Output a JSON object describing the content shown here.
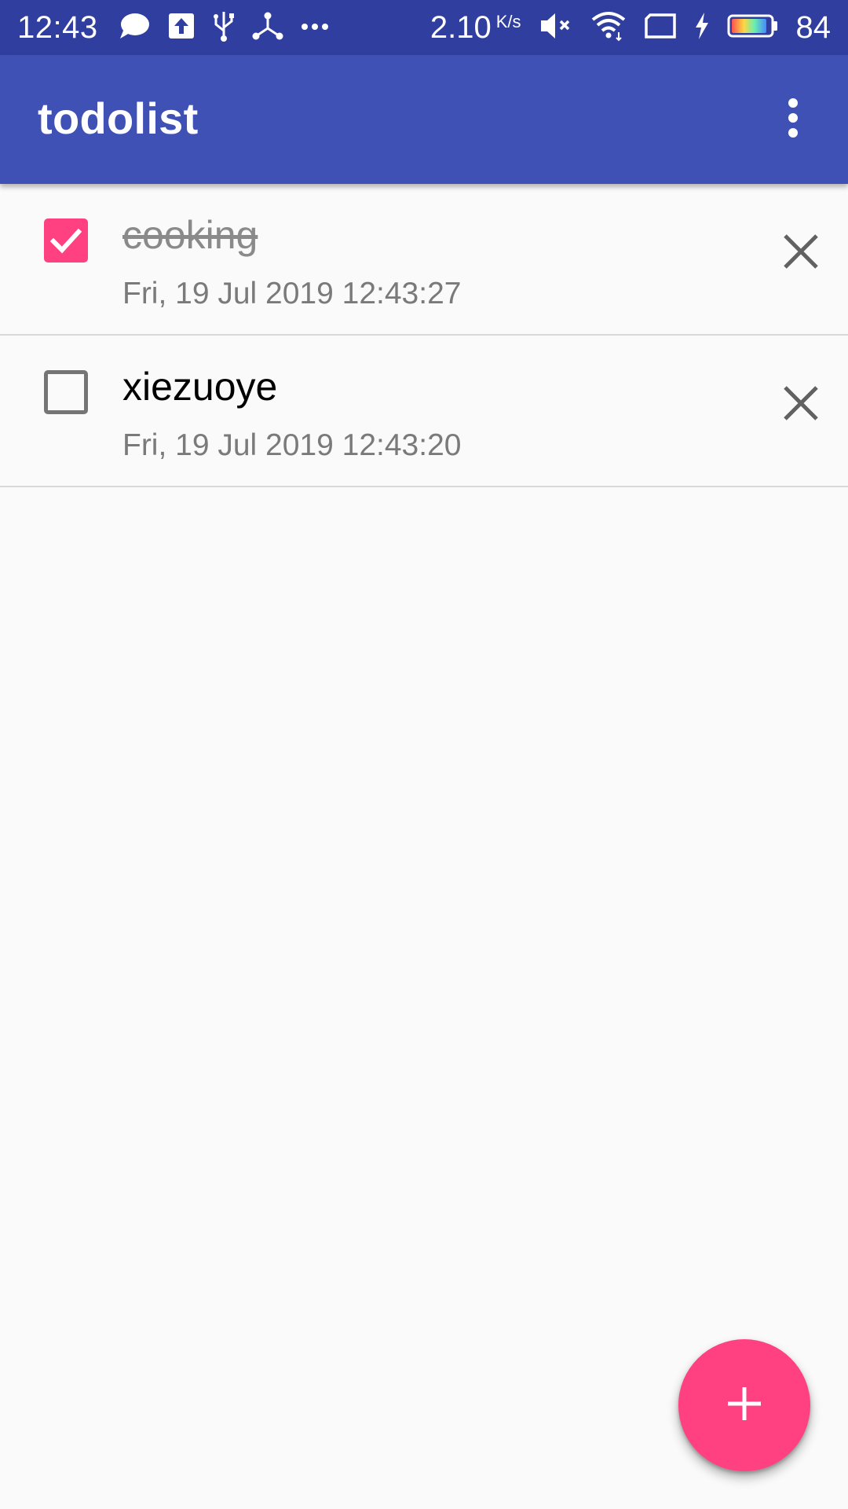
{
  "status_bar": {
    "time": "12:43",
    "net_speed": "2.10",
    "net_speed_unit": "K/s",
    "battery_percent": "84",
    "icons_left": [
      "message-icon",
      "upload-icon",
      "usb-icon",
      "hotspot-icon",
      "more-notifications-icon"
    ],
    "icons_right": [
      "mute-icon",
      "wifi-icon",
      "sim-icon",
      "charging-icon",
      "battery-icon"
    ]
  },
  "app_bar": {
    "title": "todolist",
    "overflow_icon": "more-vert-icon"
  },
  "todos": [
    {
      "title": "cooking",
      "time": "Fri, 19 Jul 2019 12:43:27",
      "done": true
    },
    {
      "title": "xiezuoye",
      "time": "Fri, 19 Jul 2019 12:43:20",
      "done": false
    }
  ],
  "fab": {
    "icon": "add-icon"
  },
  "colors": {
    "status_bar": "#303f9f",
    "primary": "#3f51b5",
    "accent": "#ff4081",
    "background": "#fafafa"
  }
}
